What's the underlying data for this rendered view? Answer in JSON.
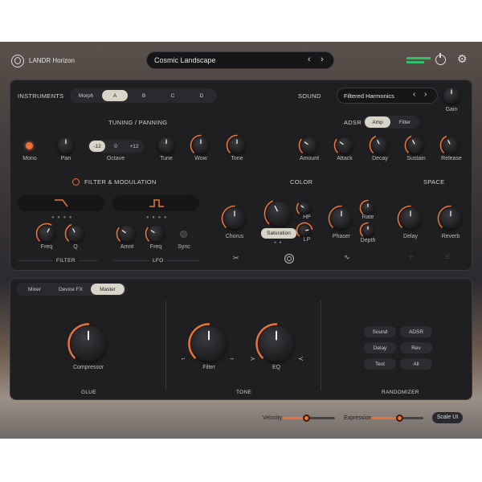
{
  "app": {
    "title": "LANDR Horizon"
  },
  "preset": {
    "name": "Cosmic Landscape"
  },
  "colors": {
    "accent": "#e8743b",
    "panel": "#1f1f22",
    "meter_green": "#2fbf6a"
  },
  "instruments": {
    "title": "INSTRUMENTS",
    "tabs": [
      "Morph",
      "A",
      "B",
      "C",
      "D"
    ],
    "selected": "A"
  },
  "sound": {
    "title": "SOUND",
    "name": "Filtered Harmonics",
    "gain_label": "Gain"
  },
  "tuning": {
    "title": "TUNING / PANNING",
    "mono": "Mono",
    "pan": "Pan",
    "octave": "Octave",
    "octave_options": [
      "-12",
      "0",
      "+12"
    ],
    "tune": "Tune",
    "wow": "Wow",
    "tone": "Tone"
  },
  "adsr": {
    "title": "ADSR",
    "tabs": [
      "Amp",
      "Filter"
    ],
    "amount": "Amount",
    "attack": "Attack",
    "decay": "Decay",
    "sustain": "Sustain",
    "release": "Release"
  },
  "filter_mod": {
    "title": "FILTER & MODULATION",
    "filter_title": "FILTER",
    "lfo_title": "LFO",
    "freq": "Freq",
    "q": "Q",
    "amnt": "Amnt",
    "lfo_freq": "Freq",
    "sync": "Sync"
  },
  "color": {
    "title": "COLOR",
    "chorus": "Chorus",
    "saturation": "Saturation",
    "hp": "HP",
    "lp": "LP",
    "phaser": "Phaser",
    "rate": "Rate",
    "depth": "Depth"
  },
  "space": {
    "title": "SPACE",
    "delay": "Delay",
    "reverb": "Reverb"
  },
  "bottom": {
    "tabs": [
      "Mixer",
      "Device FX",
      "Master"
    ],
    "selected": "Master",
    "glue": {
      "title": "GLUE",
      "compressor": "Compressor"
    },
    "tone": {
      "title": "TONE",
      "filter": "Filter",
      "eq": "EQ"
    },
    "randomizer": {
      "title": "RANDOMIZER",
      "buttons": [
        "Sound",
        "ADSR",
        "Delay",
        "Rev",
        "Text",
        "All"
      ]
    }
  },
  "footer": {
    "velocity": "Velocity",
    "expression": "Expression",
    "scale": "Scale UI",
    "velocity_level": 0.45,
    "expression_level": 0.55
  }
}
